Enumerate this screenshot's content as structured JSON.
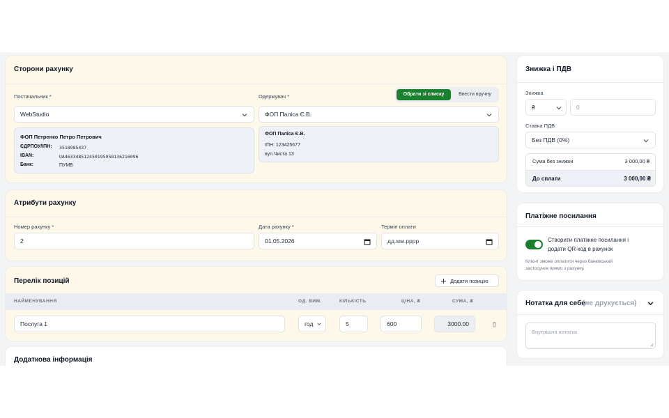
{
  "parties": {
    "title": "Сторони рахунку",
    "supplier": {
      "label": "Постачальник *",
      "value": "WebStudio",
      "card": {
        "name": "ФОП Петренко Петро Петрович",
        "edrpou_label": "ЄДРПОУ/ІПН:",
        "edrpou_value": "3518985437",
        "iban_label": "IBAN:",
        "iban_value": "UA463348512450195958136216096",
        "bank_label": "Банк:",
        "bank_value": "ПУМБ"
      }
    },
    "recipient": {
      "label": "Одержувач *",
      "btn_from_list": "Обрати зі списку",
      "btn_manual": "Ввести вручну",
      "value": "ФОП Паліса Є.В.",
      "card": {
        "name": "ФОП Паліса Є.В.",
        "ipn": "ІПН: 123425677",
        "address": "вул.Чиста 13"
      }
    }
  },
  "attributes": {
    "title": "Атрибути рахунку",
    "number_label": "Номер рахунку *",
    "number_value": "2",
    "date_label": "Дата рахунку *",
    "date_value": "01.05.2026",
    "due_label": "Термін оплати",
    "due_placeholder": "дд.мм.рррр"
  },
  "items": {
    "title": "Перелік позицій",
    "add_button": "Додати позицію",
    "headers": {
      "name": "НАЙМЕНУВАННЯ",
      "unit": "ОД. ВИМ.",
      "qty": "КІЛЬКІСТЬ",
      "price": "ЦІНА, ₴",
      "sum": "СУМА, ₴"
    },
    "rows": [
      {
        "name": "Послуга 1",
        "unit": "год",
        "qty": "5",
        "price": "600",
        "sum": "3000.00"
      }
    ]
  },
  "additional": {
    "title": "Додаткова інформація"
  },
  "discount": {
    "title": "Знижка і ПДВ",
    "discount_label": "Знижка",
    "discount_type": "₴",
    "discount_value": "0",
    "vat_label": "Ставка ПДВ",
    "vat_value": "Без ПДВ (0%)",
    "subtotal_label": "Сума без знижки",
    "subtotal_value": "3 000,00 ₴",
    "total_label": "До сплати",
    "total_value": "3 000,00 ₴"
  },
  "payment": {
    "title": "Платіжне посилання",
    "toggle_on": true,
    "toggle_text_line1": "Створити платіжне посилання і",
    "toggle_text_line2": "додати QR-код в рахунок",
    "hint_line1": "Клієнт зможе оплатити через банківський",
    "hint_line2": "застосунок прямо з рахунку."
  },
  "note": {
    "title": "Нотатка для себе",
    "title_hint": "(не друкується)",
    "placeholder": "Внутрішня нотатка"
  },
  "colors": {
    "accent_green": "#1a7f2e",
    "card_cream": "#fdf8ea",
    "info_box": "#eef1f6"
  }
}
